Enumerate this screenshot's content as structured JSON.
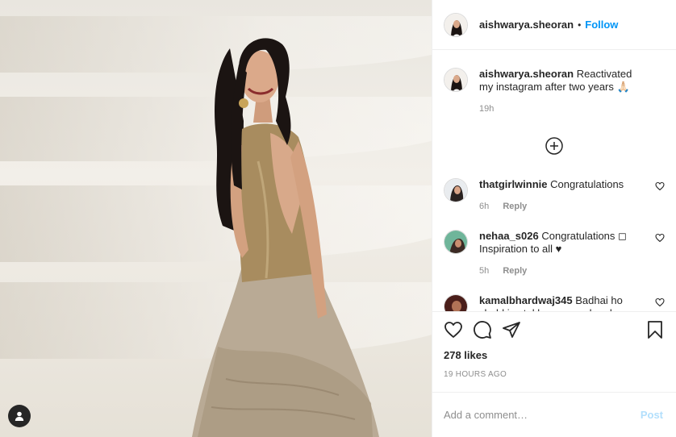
{
  "post": {
    "author": "aishwarya.sheoran",
    "separator": "•",
    "follow_label": "Follow"
  },
  "caption": {
    "username": "aishwarya.sheoran",
    "text": "Reactivated my instagram after two years 🙏🏻",
    "time": "19h"
  },
  "comments": [
    {
      "username": "thatgirlwinnie",
      "text": "Congratulations",
      "time": "6h",
      "reply_label": "Reply"
    },
    {
      "username": "nehaa_s026",
      "text": "Congratulations ◻ Inspiration to all ♥",
      "time": "5h",
      "reply_label": "Reply"
    },
    {
      "username": "kamalbhardwaj345",
      "text": "Badhai ho chubkiya tal ka nam roshan kar duya",
      "time": "",
      "reply_label": ""
    }
  ],
  "likes": "278 likes",
  "time_ago": "19 HOURS AGO",
  "add_comment": {
    "placeholder": "Add a comment…",
    "post_label": "Post"
  },
  "colors": {
    "accent": "#0095f6",
    "post_disabled": "#b2dffc",
    "muted": "#8e8e8e"
  },
  "icons": [
    "plus-circle-icon",
    "heart-icon",
    "comment-icon",
    "share-icon",
    "bookmark-icon",
    "user-tag-icon"
  ]
}
